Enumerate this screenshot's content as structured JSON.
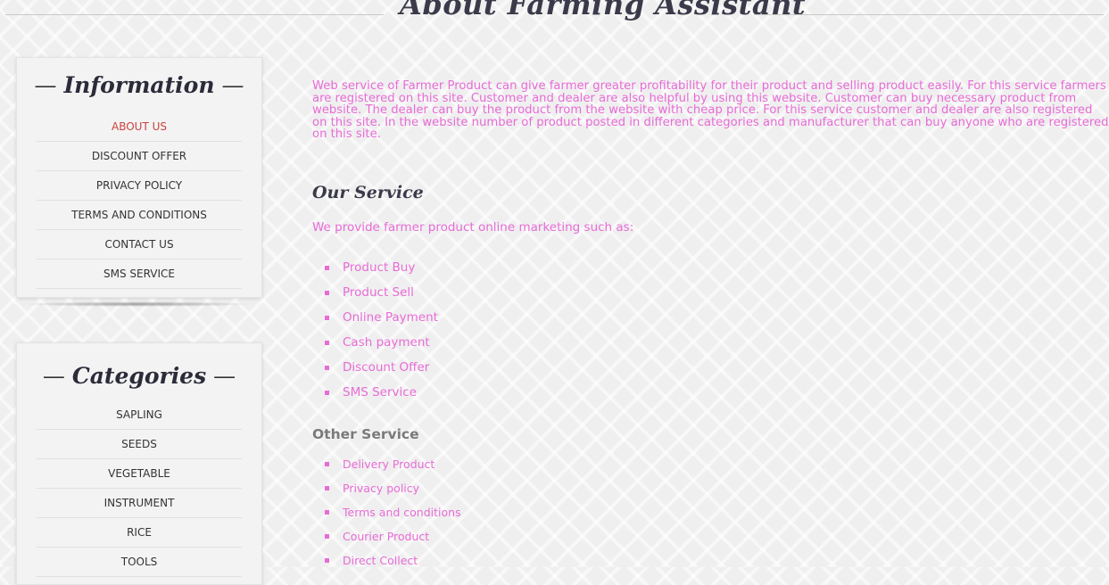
{
  "page_title": "About Farming Assistant",
  "sidebar": {
    "information": {
      "title": "Information",
      "items": [
        {
          "label": "ABOUT US",
          "active": true
        },
        {
          "label": "DISCOUNT OFFER"
        },
        {
          "label": "PRIVACY POLICY"
        },
        {
          "label": "TERMS AND CONDITIONS"
        },
        {
          "label": "CONTACT US"
        },
        {
          "label": "SMS SERVICE"
        }
      ]
    },
    "categories": {
      "title": "Categories",
      "items": [
        {
          "label": "SAPLING"
        },
        {
          "label": "SEEDS"
        },
        {
          "label": "VEGETABLE"
        },
        {
          "label": "INSTRUMENT"
        },
        {
          "label": "RICE"
        },
        {
          "label": "TOOLS"
        }
      ]
    }
  },
  "content": {
    "intro": "Web service of Farmer Product can give farmer greater profitability for their product and selling product easily. For this service farmers are registered on this site. Customer and dealer are also helpful by using this website. Customer can buy necessary product from website. The dealer can buy the product from the website with cheap price. For this service customer and dealer are also registered on this site. In the website number of product posted in different categories and manufacturer that can buy anyone who are registered on this site.",
    "our_service": {
      "heading": "Our Service",
      "lead": "We provide farmer product online marketing such as:",
      "items": [
        "Product Buy",
        "Product Sell",
        "Online Payment",
        "Cash payment",
        "Discount Offer",
        "SMS Service"
      ]
    },
    "other_service": {
      "heading": "Other Service",
      "items": [
        "Delivery Product",
        "Privacy policy",
        "Terms and conditions",
        "Courier Product",
        "Direct Collect"
      ]
    }
  },
  "colors": {
    "accent_pink": "#e86bd6",
    "active_red": "#c9423e",
    "heading_dark": "#3a3a4a"
  }
}
